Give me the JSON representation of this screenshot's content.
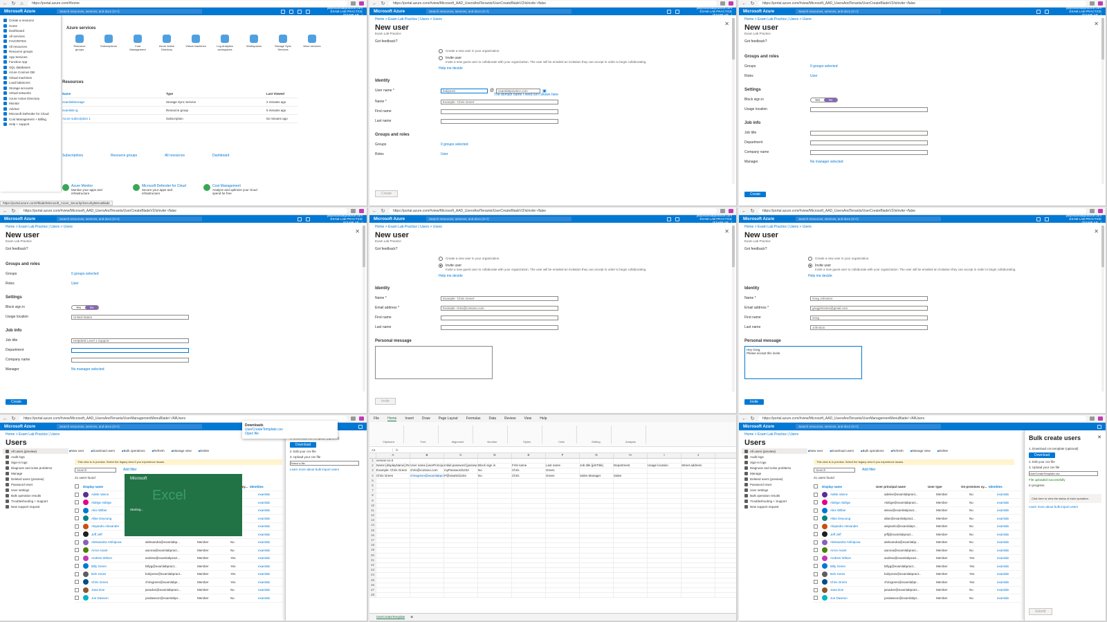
{
  "browser": {
    "home_url": "https://portal.azure.com/#home",
    "create_url": "https://portal.azure.com/#view/Microsoft_AAD_UsersAndTenants/UserCreateBladeV2/isInvite~/false",
    "users_url": "https://portal.azure.com/#view/Microsoft_AAD_UsersAndTenants/UserManagementMenuBlade/~/AllUsers",
    "status_url": "https://portal.azure.com/#blade/Microsoft_Azure_Security/SecurityMenuBlade"
  },
  "portal": {
    "brand": "Microsoft Azure",
    "search_placeholder": "Search resources, services, and docs (G+/)",
    "account_line1": "jill@examlabpractice.com",
    "account_line2": "EXAM LAB PRACTICE (EXAMLAB...)"
  },
  "home": {
    "menu": [
      "Create a resource",
      "Home",
      "Dashboard",
      "All services",
      "FAVORITES",
      "All resources",
      "Resource groups",
      "App Services",
      "Function App",
      "SQL databases",
      "Azure Cosmos DB",
      "Virtual machines",
      "Load balancers",
      "Storage accounts",
      "Virtual networks",
      "Azure Active Directory",
      "Monitor",
      "Advisor",
      "Microsoft Defender for Cloud",
      "Cost Management + Billing",
      "Help + support"
    ],
    "services_heading": "Azure services",
    "services": [
      "Resource groups",
      "Subscriptions",
      "Cost Management",
      "Azure Active Directory",
      "Virtual machines",
      "Log Analytics workspaces",
      "Workspaces",
      "Storage Sync Services",
      "More services"
    ],
    "resources_heading": "Resources",
    "resources_cols": [
      "Name",
      "Type",
      "Last Viewed"
    ],
    "resources": [
      {
        "name": "examlabstorage",
        "type": "Storage Sync Service",
        "viewed": "2 minutes ago"
      },
      {
        "name": "examlab-rg",
        "type": "Resource group",
        "viewed": "5 minutes ago"
      },
      {
        "name": "Azure subscription 1",
        "type": "Subscription",
        "viewed": "52 minutes ago"
      }
    ],
    "navigate": [
      "Subscriptions",
      "Resource groups",
      "All resources",
      "Dashboard"
    ],
    "tools": [
      {
        "title": "Azure Monitor",
        "desc": "Monitor your apps and infrastructure"
      },
      {
        "title": "Microsoft Defender for Cloud",
        "desc": "Secure your apps and infrastructure"
      },
      {
        "title": "Cost Management",
        "desc": "Analyze and optimize your cloud spend for free"
      }
    ]
  },
  "newuser": {
    "breadcrumb": "Home > Exam Lab Practice | Users > Users",
    "title": "New user",
    "subtitle": "Exam Lab Practice",
    "feedback": "Got feedback?",
    "create_label": "Create user",
    "create_desc": "Create a new user in your organization.",
    "invite_label": "Invite user",
    "invite_desc": "Invite a new guest user to collaborate with your organization. The user will be emailed an invitation they can accept in order to begin collaborating.",
    "help_link": "Help me decide",
    "identity": "Identity",
    "username_label": "User name *",
    "username_value": "bobjones",
    "domain_value": "examlabpractice.com",
    "domain_note": "The domain name I need isn't shown here",
    "name_label": "Name *",
    "name_placeholder": "Example: 'Chris Green'",
    "first_name": "First name",
    "last_name": "Last name",
    "email_label": "Email address *",
    "email_placeholder": "Example: chris@contoso.com",
    "groups_roles": "Groups and roles",
    "groups_label": "Groups",
    "groups_value": "0 groups selected",
    "roles_label": "Roles",
    "roles_value": "User",
    "settings": "Settings",
    "block_label": "Block sign in",
    "yes": "Yes",
    "no": "No",
    "usage_label": "Usage location",
    "usage_value": "United States",
    "jobinfo": "Job info",
    "jobtitle_label": "Job title",
    "jobtitle_value": "Helpdesk Level 1 Support",
    "dept_label": "Department",
    "company_label": "Company name",
    "manager_label": "Manager",
    "manager_value": "No manager selected",
    "create_btn": "Create",
    "invite_btn": "Invite",
    "personal_message": "Personal message",
    "invite_name": "Greg Johnston",
    "invite_email": "gregjohnston@gmail.com",
    "invite_first": "Greg",
    "invite_last": "Johnston",
    "invite_msg": "Hey Greg,\nPlease accept this invite."
  },
  "users": {
    "breadcrumb": "Home > Exam Lab Practice | Users",
    "title": "Users",
    "side": [
      "All users (preview)",
      "Audit logs",
      "Sign-in logs",
      "Diagnose and solve problems",
      "Manage",
      "Deleted users (preview)",
      "Password reset",
      "User settings",
      "Bulk operation results",
      "Troubleshooting + Support",
      "New support request"
    ],
    "toolbar": [
      "New user",
      "Download users",
      "Bulk operations",
      "Refresh",
      "Manage view",
      "Delete"
    ],
    "banner": "This view is in preview. Select the legacy view if you experience issues.",
    "found": "21 users found",
    "search_placeholder": "Search",
    "add_filter": "Add filter",
    "cols": [
      "Display name",
      "User principal name",
      "User type",
      "On-premises sy...",
      "Identities"
    ],
    "rows": [
      {
        "name": "Adele Vance",
        "upn": "adelev@examlabpract...",
        "type": "Member",
        "onp": "No",
        "id": "examlab"
      },
      {
        "name": "Aldrige Aldrige",
        "upn": "Aldrige@examlabpract...",
        "type": "Member",
        "onp": "No",
        "id": "examlab"
      },
      {
        "name": "Alex Wilber",
        "upn": "alexw@examlabpract...",
        "type": "Member",
        "onp": "No",
        "id": "examlab"
      },
      {
        "name": "Allan Deyoung",
        "upn": "allan@examlabpract...",
        "type": "Member",
        "onp": "No",
        "id": "examlab"
      },
      {
        "name": "Alejandro Alexander",
        "upn": "alejandro@examlabpr...",
        "type": "Member",
        "onp": "No",
        "id": "examlab"
      },
      {
        "name": "Jeff Jeff",
        "upn": "jeffj@examlabpract...",
        "type": "Member",
        "onp": "No",
        "id": "examlab"
      },
      {
        "name": "Aleksandra Arkhipova",
        "upn": "aleksandra@examlabp...",
        "type": "Member",
        "onp": "No",
        "id": "examlab"
      },
      {
        "name": "Arron Avant",
        "upn": "aarona@examlabpract...",
        "type": "Member",
        "onp": "No",
        "id": "examlab"
      },
      {
        "name": "Andrew Wilson",
        "upn": "andrew@examlabpract...",
        "type": "Member",
        "onp": "Yes",
        "id": "examlab"
      },
      {
        "name": "Billy Green",
        "upn": "billyg@examlabpract...",
        "type": "Member",
        "onp": "Yes",
        "id": "examlab"
      },
      {
        "name": "Bob Jones",
        "upn": "bobjones@examlabpract...",
        "type": "Member",
        "onp": "Yes",
        "id": "examlab"
      },
      {
        "name": "Chris Green",
        "upn": "chrisgreen@examlabpr...",
        "type": "Member",
        "onp": "Yes",
        "id": "examlab"
      },
      {
        "name": "Jana Doe",
        "upn": "janadoe@examlabpract...",
        "type": "Member",
        "onp": "No",
        "id": "examlab"
      },
      {
        "name": "Joe Dawson",
        "upn": "joedawson@examlabpr...",
        "type": "Member",
        "onp": "No",
        "id": "examlab"
      }
    ],
    "avatar_colors": [
      "#5c2e91",
      "#e3008c",
      "#0078d4",
      "#038387",
      "#ca5010",
      "#201f1e",
      "#8764b8",
      "#498205",
      "#c239b3",
      "#0078d4",
      "#605e5c",
      "#004e8c",
      "#8e562e",
      "#00b7c3"
    ]
  },
  "downloads": {
    "title": "Downloads",
    "file": "UserCreateTemplate.csv",
    "link": "Open file"
  },
  "excel_splash": {
    "ms": "Microsoft",
    "big": "Excel",
    "starting": "Starting..."
  },
  "bulk": {
    "title": "Bulk create users",
    "step1": "1. Download csv template (optional)",
    "download": "Download",
    "step2": "2. Edit your csv file",
    "step3": "3. Upload your csv file",
    "file_placeholder": "Select a file",
    "uploaded": "File uploaded successfully",
    "in_progress": "In progress",
    "info": "Click here to view the status of each operation.",
    "learn": "Learn more about bulk import users",
    "submit": "Submit"
  },
  "excel": {
    "tabs": [
      "File",
      "Home",
      "Insert",
      "Draw",
      "Page Layout",
      "Formulas",
      "Data",
      "Review",
      "View",
      "Help"
    ],
    "groups": [
      "Clipboard",
      "Font",
      "Alignment",
      "Number",
      "Styles",
      "Cells",
      "Editing",
      "Analysis"
    ],
    "namebox": "A1",
    "cols": [
      "A",
      "B",
      "C",
      "D",
      "E",
      "F",
      "G",
      "H",
      "I",
      "J"
    ],
    "rows": [
      [
        "version:v1.0",
        "",
        "",
        "",
        "",
        "",
        "",
        "",
        "",
        ""
      ],
      [
        "Name [displayName] Required",
        "User name [userPrincipalName] Required",
        "Initial password [passwordProfile] Required",
        "Block sign in",
        "First name",
        "Last name",
        "Job title [jobTitle]",
        "Department",
        "Usage location",
        "Street address"
      ],
      [
        "Example: Chris Green",
        "chris@contoso.com",
        "myPassword1234",
        "No",
        "Chris",
        "Green",
        "",
        "",
        "",
        ""
      ],
      [
        "Chris Green",
        "chrisgreen@examlabpractice.com",
        "P@ssw0rd1234",
        "No",
        "Chris",
        "Green",
        "Sales Manager",
        "Sales",
        "",
        ""
      ]
    ],
    "sheet_tab": "UserCreateTemplate"
  }
}
